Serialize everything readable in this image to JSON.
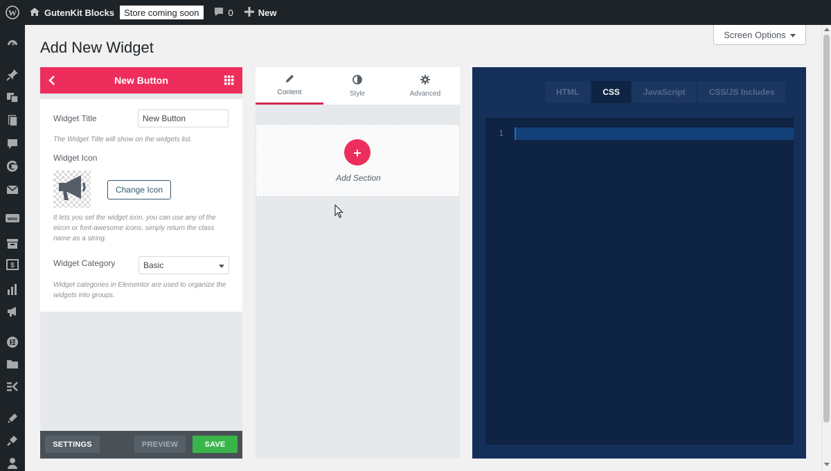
{
  "admin_bar": {
    "site_name": "GutenKit Blocks",
    "store_badge": "Store coming soon",
    "comments_count": "0",
    "new_label": "New"
  },
  "sidebar": {
    "icons": [
      "dashboard-icon",
      "pin-icon",
      "media-icon",
      "pages-icon",
      "comments-icon",
      "gutenkit-icon",
      "mail-icon",
      "woo-icon",
      "products-icon",
      "payments-icon",
      "analytics-icon",
      "marketing-icon",
      "elementor-icon",
      "templates-icon",
      "elementskit-icon",
      "appearance-icon",
      "plugins-icon",
      "users-icon"
    ]
  },
  "page": {
    "title": "Add New Widget",
    "screen_options": "Screen Options"
  },
  "widget_panel": {
    "header_title": "New Button",
    "widget_title_label": "Widget Title",
    "widget_title_value": "New Button",
    "widget_title_help": "The Widget Title will show on the widgets list.",
    "widget_icon_label": "Widget Icon",
    "change_icon_button": "Change Icon",
    "widget_icon_help": "It lets you set the widget icon. you can use any of the eicon or font-awesome icons, simply return the class name as a string.",
    "widget_category_label": "Widget Category",
    "widget_category_value": "Basic",
    "widget_category_help": "Widget categories in Elementor are used to organize the widgets into groups.",
    "footer": {
      "settings": "SETTINGS",
      "preview": "PREVIEW",
      "save": "SAVE"
    }
  },
  "editor": {
    "tabs": [
      {
        "label": "Content",
        "icon": "pencil-icon"
      },
      {
        "label": "Style",
        "icon": "half-circle-icon"
      },
      {
        "label": "Advanced",
        "icon": "gear-icon"
      }
    ],
    "active_tab": "Content",
    "add_section_label": "Add Section"
  },
  "code_panel": {
    "tabs": [
      "HTML",
      "CSS",
      "JavaScript",
      "CSS/JS Includes"
    ],
    "active_tab": "CSS",
    "line_number": "1"
  },
  "colors": {
    "accent": "#ed2d5b",
    "save_green": "#39b54a",
    "code_bg": "#14305a",
    "admin_bar": "#1d2327"
  }
}
